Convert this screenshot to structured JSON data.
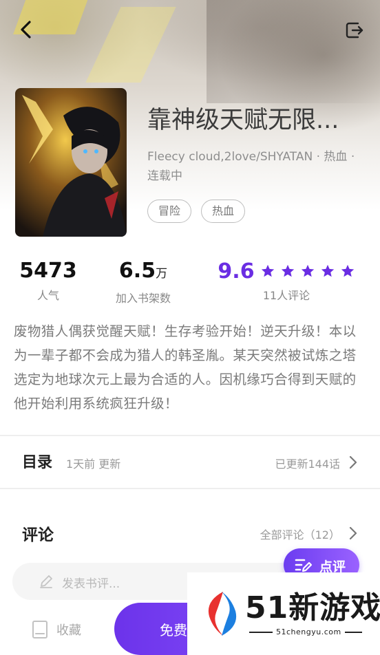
{
  "header": {
    "back_icon": "chevron-left-icon",
    "share_icon": "share-exit-icon"
  },
  "book": {
    "title": "靠神级天赋无限...",
    "meta": "Fleecy cloud,2love/SHYATAN · 热血 · 连载中",
    "tags": [
      "冒险",
      "热血"
    ]
  },
  "stats": {
    "popularity": {
      "value": "5473",
      "label": "人气"
    },
    "shelf": {
      "value": "6.5",
      "unit": "万",
      "label": "加入书架数"
    },
    "rating": {
      "value": "9.6",
      "stars": 5,
      "label": "11人评论",
      "color": "#6a2de3"
    }
  },
  "description": "废物猎人偶获觉醒天赋！生存考验开始！逆天升级！本以为一辈子都不会成为猎人的韩圣胤。某天突然被试炼之塔选定为地球次元上最为合适的人。因机缘巧合得到天赋的他开始利用系统疯狂升级！",
  "catalog": {
    "title": "目录",
    "updated": "1天前 更新",
    "progress": "已更新144话"
  },
  "comments": {
    "title": "评论",
    "all_label": "全部评论（12）",
    "input_placeholder": "发表书评...",
    "review_button": "点评"
  },
  "bottom_bar": {
    "favorite_label": "收藏",
    "read_label": "免费",
    "accent": "#6c33ea"
  },
  "watermark": {
    "brand": "51新游戏",
    "url": "51chengyu.com"
  }
}
